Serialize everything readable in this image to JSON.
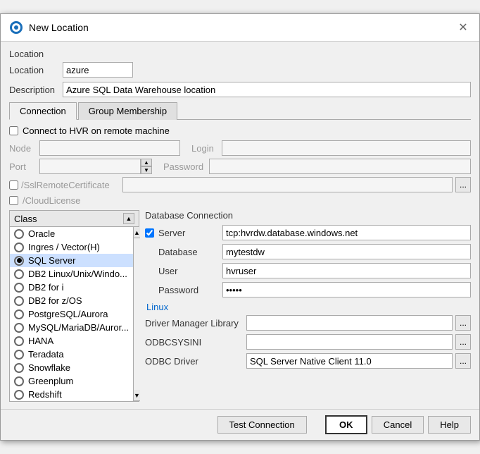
{
  "title": "New Location",
  "close_icon": "✕",
  "location_section_label": "Location",
  "location_label": "Location",
  "location_value": "azure",
  "description_label": "Description",
  "description_value": "Azure SQL Data Warehouse location",
  "tabs": [
    {
      "label": "Connection",
      "active": true
    },
    {
      "label": "Group Membership",
      "active": false
    }
  ],
  "connect_checkbox_label": "Connect to HVR on remote machine",
  "connect_checked": false,
  "node_label": "Node",
  "node_value": "",
  "login_label": "Login",
  "login_value": "",
  "port_label": "Port",
  "port_value": "",
  "password_label": "Password",
  "password_value": "",
  "ssl_label": "/SslRemoteCertificate",
  "ssl_value": "",
  "ssl_checked": false,
  "cloud_license_label": "/CloudLicense",
  "cloud_license_checked": false,
  "class_header": "Class",
  "class_items": [
    {
      "label": "Oracle",
      "selected": false
    },
    {
      "label": "Ingres / Vector(H)",
      "selected": false
    },
    {
      "label": "SQL Server",
      "selected": true
    },
    {
      "label": "DB2 Linux/Unix/Windo...",
      "selected": false
    },
    {
      "label": "DB2 for i",
      "selected": false
    },
    {
      "label": "DB2 for z/OS",
      "selected": false
    },
    {
      "label": "PostgreSQL/Aurora",
      "selected": false
    },
    {
      "label": "MySQL/MariaDB/Auror...",
      "selected": false
    },
    {
      "label": "HANA",
      "selected": false
    },
    {
      "label": "Teradata",
      "selected": false
    },
    {
      "label": "Snowflake",
      "selected": false
    },
    {
      "label": "Greenplum",
      "selected": false
    },
    {
      "label": "Redshift",
      "selected": false
    }
  ],
  "db_section_label": "Database Connection",
  "server_checked": true,
  "server_label": "Server",
  "server_value": "tcp:hvrdw.database.windows.net",
  "database_label": "Database",
  "database_value": "mytestdw",
  "user_label": "User",
  "user_value": "hvruser",
  "db_password_label": "Password",
  "db_password_value": "●●●●●",
  "linux_label": "Linux",
  "driver_manager_label": "Driver Manager Library",
  "driver_manager_value": "",
  "odbcsysini_label": "ODBCSYSINI",
  "odbcsysini_value": "",
  "odbc_driver_label": "ODBC Driver",
  "odbc_driver_value": "SQL Server Native Client 11.0",
  "btn_test": "Test Connection",
  "btn_ok": "OK",
  "btn_cancel": "Cancel",
  "btn_help": "Help"
}
